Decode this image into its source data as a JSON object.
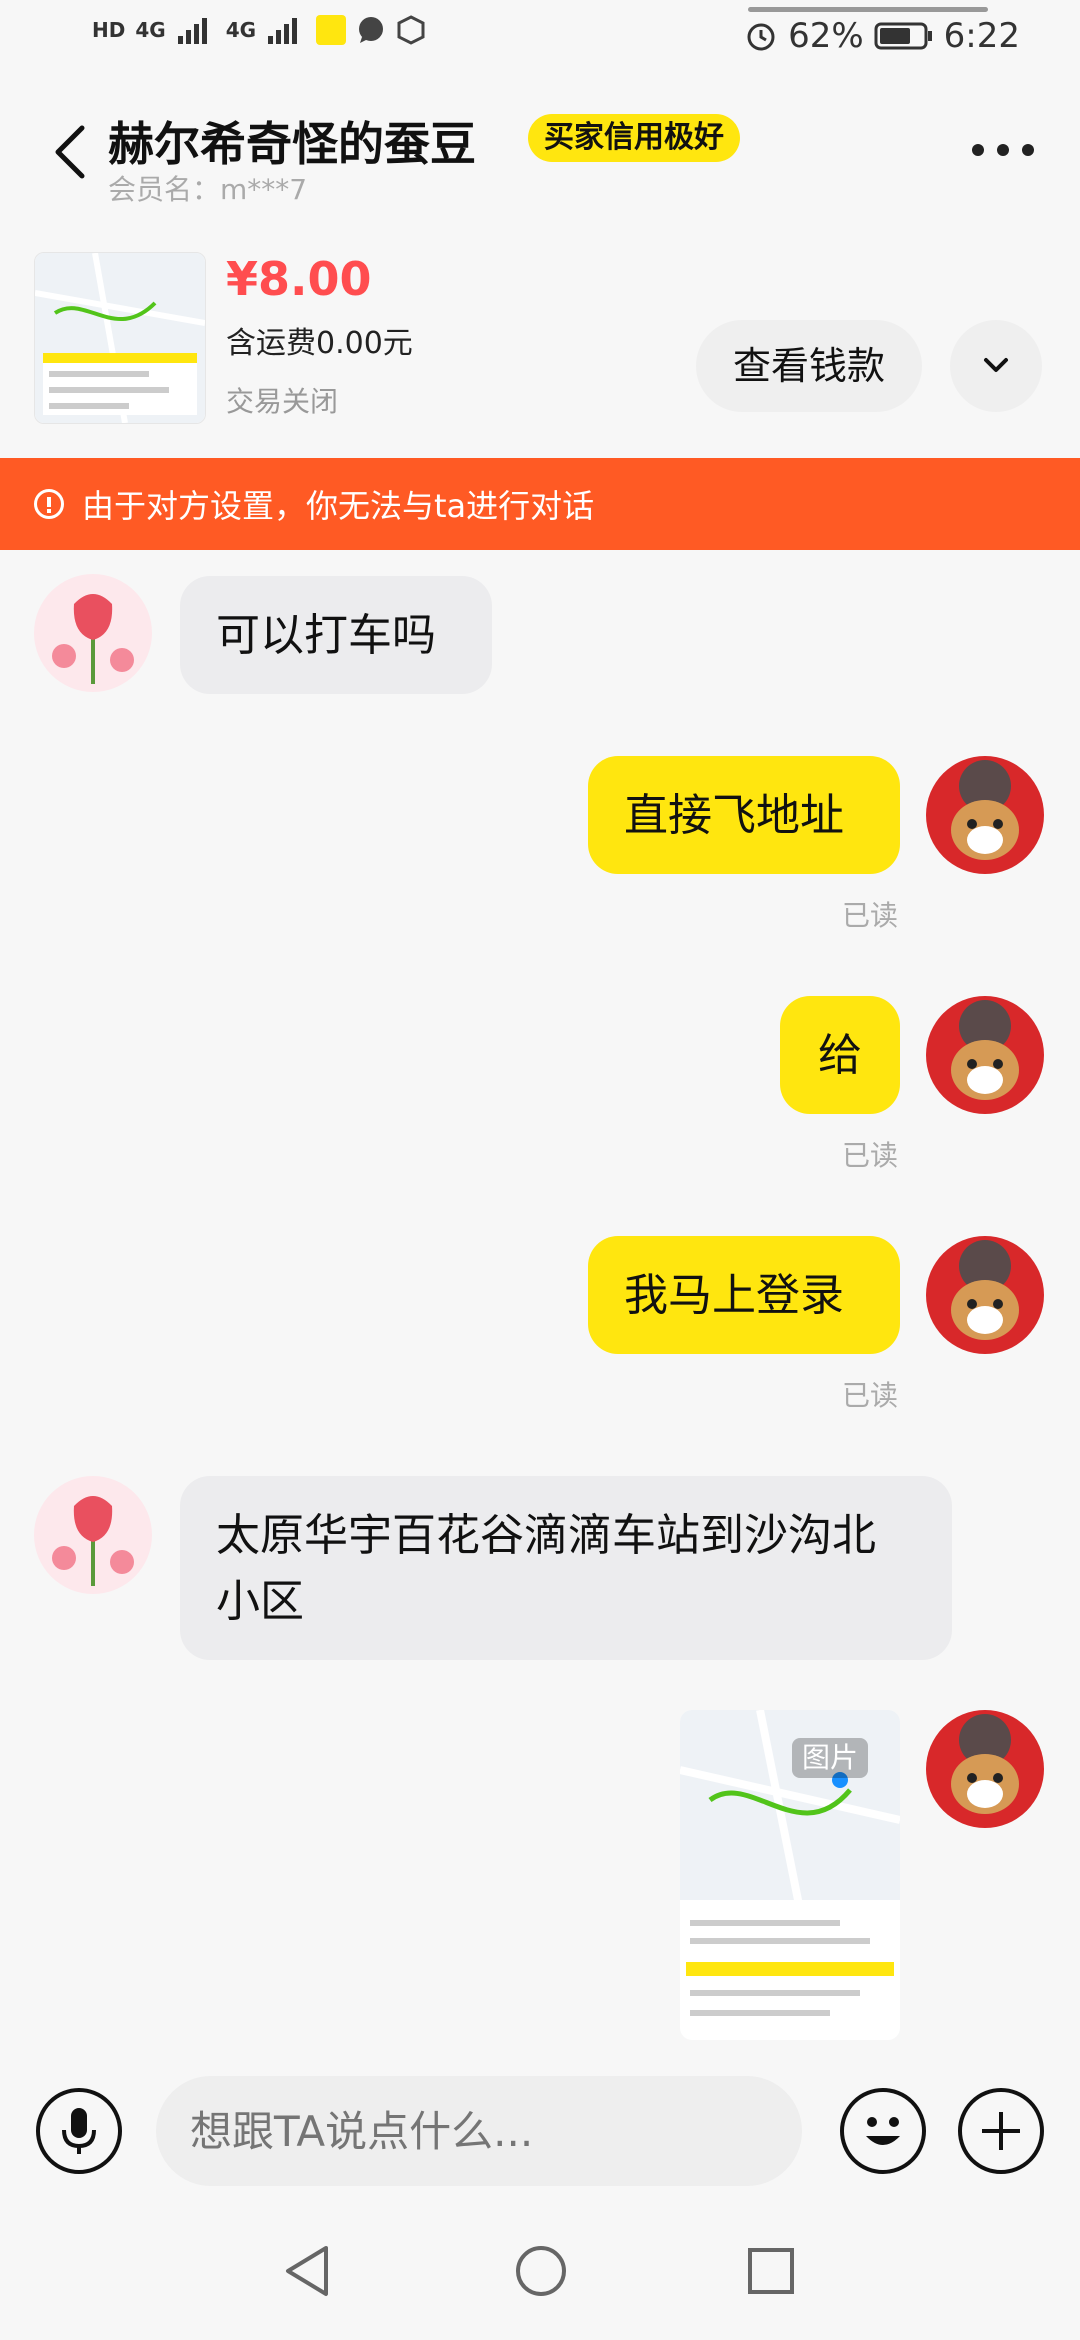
{
  "status_bar": {
    "left_indicators": [
      "HD",
      "4G",
      "4G"
    ],
    "battery": "62%",
    "time": "6:22"
  },
  "header": {
    "nickname": "赫尔希奇怪的蚕豆",
    "credit_badge": "买家信用极好",
    "member_label": "会员名：",
    "member_id": "m***7",
    "more_icon": "more-dots-icon"
  },
  "product": {
    "price": "¥8.00",
    "shipping": "含运费0.00元",
    "status": "交易关闭",
    "check_payment_label": "查看钱款",
    "expand_icon": "chevron-down-icon"
  },
  "banner": {
    "text": "由于对方设置，你无法与ta进行对话",
    "icon": "alert-circle-icon",
    "color": "#ff5a24"
  },
  "messages": [
    {
      "side": "left",
      "text": "可以打车吗"
    },
    {
      "side": "right",
      "text": "直接飞地址",
      "read": "已读"
    },
    {
      "side": "right",
      "text": "给",
      "read": "已读"
    },
    {
      "side": "right",
      "text": "我马上登录",
      "read": "已读"
    },
    {
      "side": "left",
      "text": "太原华宇百花谷滴滴车站到沙沟北小区"
    },
    {
      "side": "right",
      "type": "image",
      "badge": "图片"
    }
  ],
  "input_bar": {
    "voice_icon": "microphone-icon",
    "placeholder": "想跟TA说点什么...",
    "emoji_icon": "emoji-icon",
    "plus_icon": "plus-icon"
  },
  "nav_bar": {
    "back_icon": "nav-back-icon",
    "home_icon": "nav-home-icon",
    "recents_icon": "nav-recents-icon"
  },
  "colors": {
    "accent_yellow": "#ffe60f",
    "price_red": "#ff4d4f",
    "banner_orange": "#ff5a24"
  }
}
